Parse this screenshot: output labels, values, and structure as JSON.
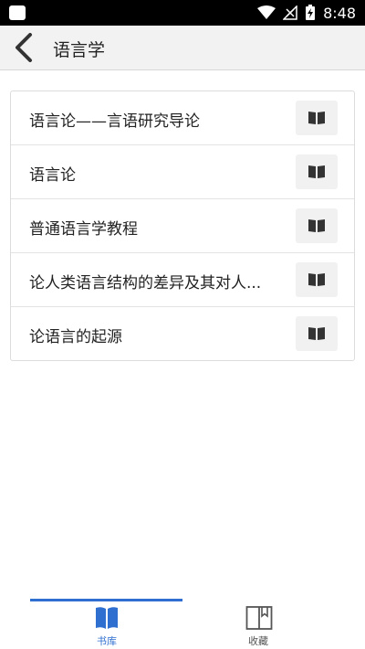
{
  "status_bar": {
    "time": "8:48"
  },
  "app_bar": {
    "title": "语言学"
  },
  "books": [
    {
      "title": "语言论——言语研究导论"
    },
    {
      "title": "语言论"
    },
    {
      "title": "普通语言学教程"
    },
    {
      "title": "论人类语言结构的差异及其对人..."
    },
    {
      "title": "论语言的起源"
    }
  ],
  "bottom_nav": {
    "items": [
      {
        "label": "书库",
        "icon": "book-open-icon",
        "active": true
      },
      {
        "label": "收藏",
        "icon": "bookmark-book-icon",
        "active": false
      }
    ]
  },
  "colors": {
    "accent": "#2f6fd0",
    "app_bar": "#f2f2f2",
    "status_bar": "#000000"
  }
}
